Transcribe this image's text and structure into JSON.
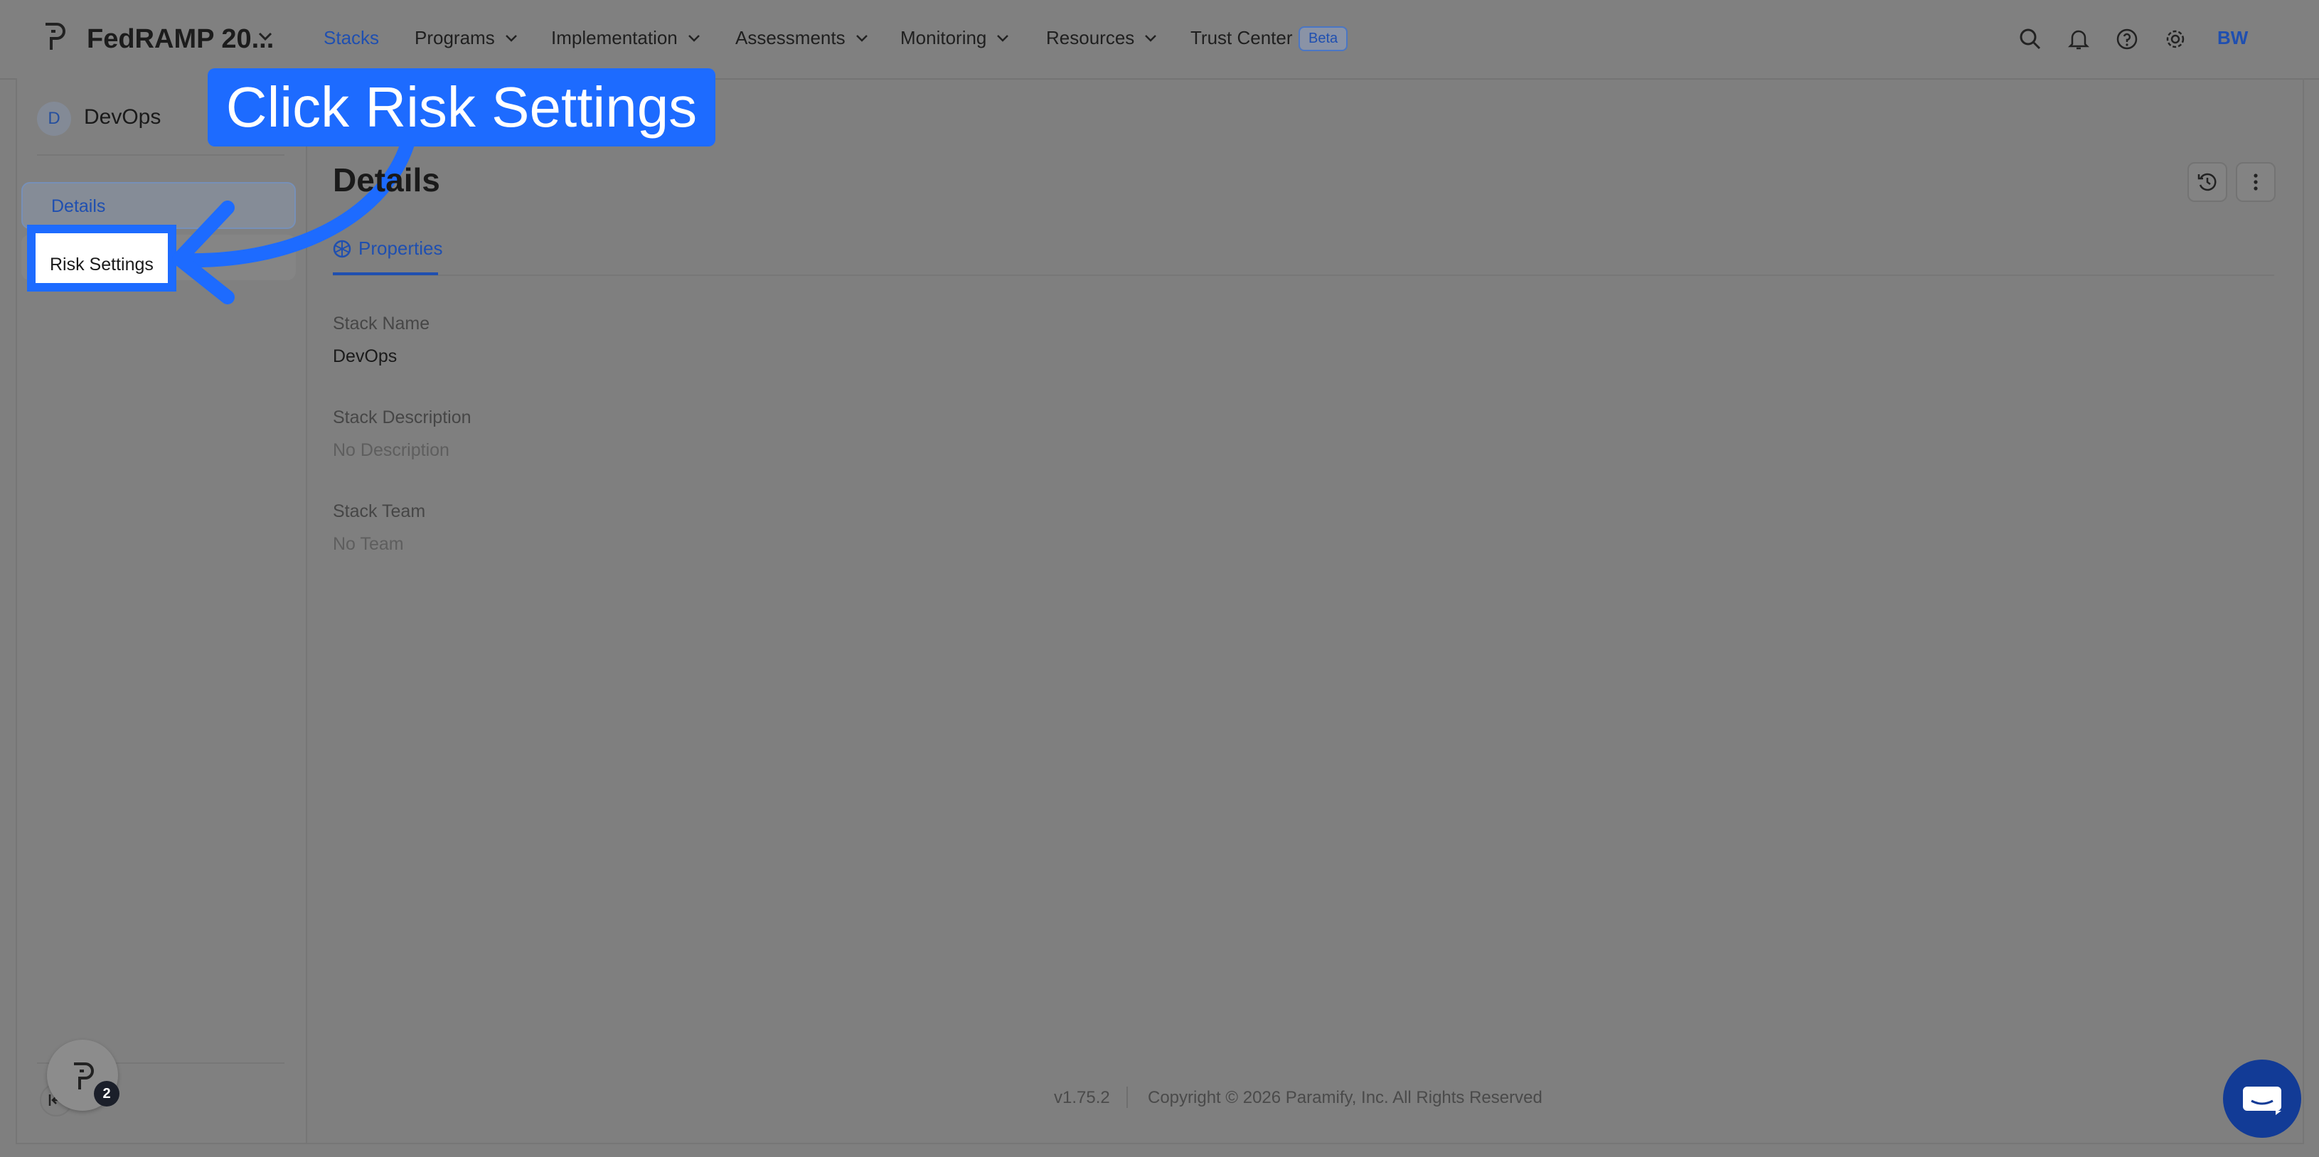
{
  "header": {
    "app_title": "FedRAMP 20...",
    "nav": [
      {
        "label": "Stacks"
      },
      {
        "label": "Programs"
      },
      {
        "label": "Implementation"
      },
      {
        "label": "Assessments"
      },
      {
        "label": "Monitoring"
      },
      {
        "label": "Resources"
      },
      {
        "label": "Trust Center"
      }
    ],
    "beta_badge": "Beta",
    "avatar_initials": "BW",
    "icons": [
      "search-icon",
      "bell-icon",
      "help-icon",
      "gear-icon"
    ]
  },
  "sidebar": {
    "stack_initial": "D",
    "stack_name": "DevOps",
    "items": [
      {
        "label": "Details",
        "active": true
      },
      {
        "label": "Risk Settings",
        "active": false
      }
    ],
    "notification_count": "2"
  },
  "callout": {
    "text": "Click Risk Settings",
    "color": "#1d6bff"
  },
  "main": {
    "title": "Details",
    "tabs": [
      {
        "label": "Properties"
      }
    ],
    "fields": [
      {
        "label": "Stack Name",
        "value": "DevOps"
      },
      {
        "label": "Stack Description",
        "value": "No Description"
      },
      {
        "label": "Stack Team",
        "value": "No Team"
      }
    ]
  },
  "footer": {
    "version": "v1.75.2",
    "copyright": "Copyright © 2026 Paramify, Inc. All Rights Reserved"
  },
  "colors": {
    "accent": "#1f4fb0",
    "overlay": "#7f7f7f",
    "highlight": "#1d6bff"
  }
}
